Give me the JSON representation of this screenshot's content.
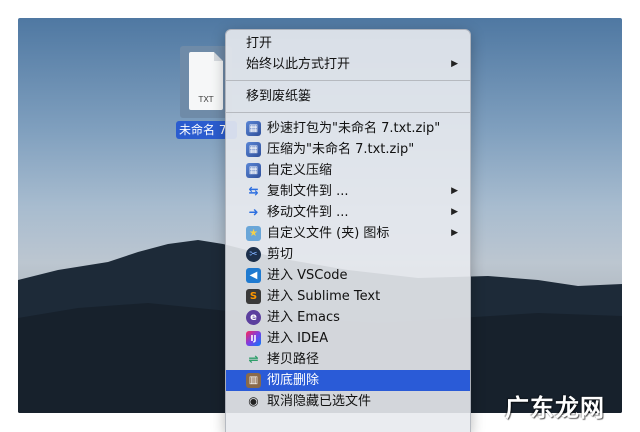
{
  "file": {
    "ext": "TXT",
    "label": "未命名 7"
  },
  "menu": {
    "open": "打开",
    "open_with": "始终以此方式打开",
    "trash": "移到废纸篓",
    "items": [
      {
        "label": "秒速打包为\"未命名 7.txt.zip\"",
        "icon": "archive-icon"
      },
      {
        "label": "压缩为\"未命名 7.txt.zip\"",
        "icon": "archive-icon"
      },
      {
        "label": "自定义压缩",
        "icon": "archive-icon"
      },
      {
        "label": "复制文件到 ...",
        "icon": "copy-arrow-icon"
      },
      {
        "label": "移动文件到 ...",
        "icon": "move-arrow-icon"
      },
      {
        "label": "自定义文件 (夹) 图标",
        "icon": "custom-folder-icon"
      },
      {
        "label": "剪切",
        "icon": "scissors-icon"
      },
      {
        "label": "进入 VSCode",
        "icon": "vscode-icon"
      },
      {
        "label": "进入 Sublime Text",
        "icon": "sublime-icon"
      },
      {
        "label": "进入 Emacs",
        "icon": "emacs-icon"
      },
      {
        "label": "进入 IDEA",
        "icon": "idea-icon"
      },
      {
        "label": "拷贝路径",
        "icon": "path-icon"
      },
      {
        "label": "彻底删除",
        "icon": "shredder-icon"
      },
      {
        "label": "取消隐藏已选文件",
        "icon": "eye-icon"
      }
    ],
    "highlight_color": "#2a5bd7"
  },
  "watermark": "广东龙网"
}
